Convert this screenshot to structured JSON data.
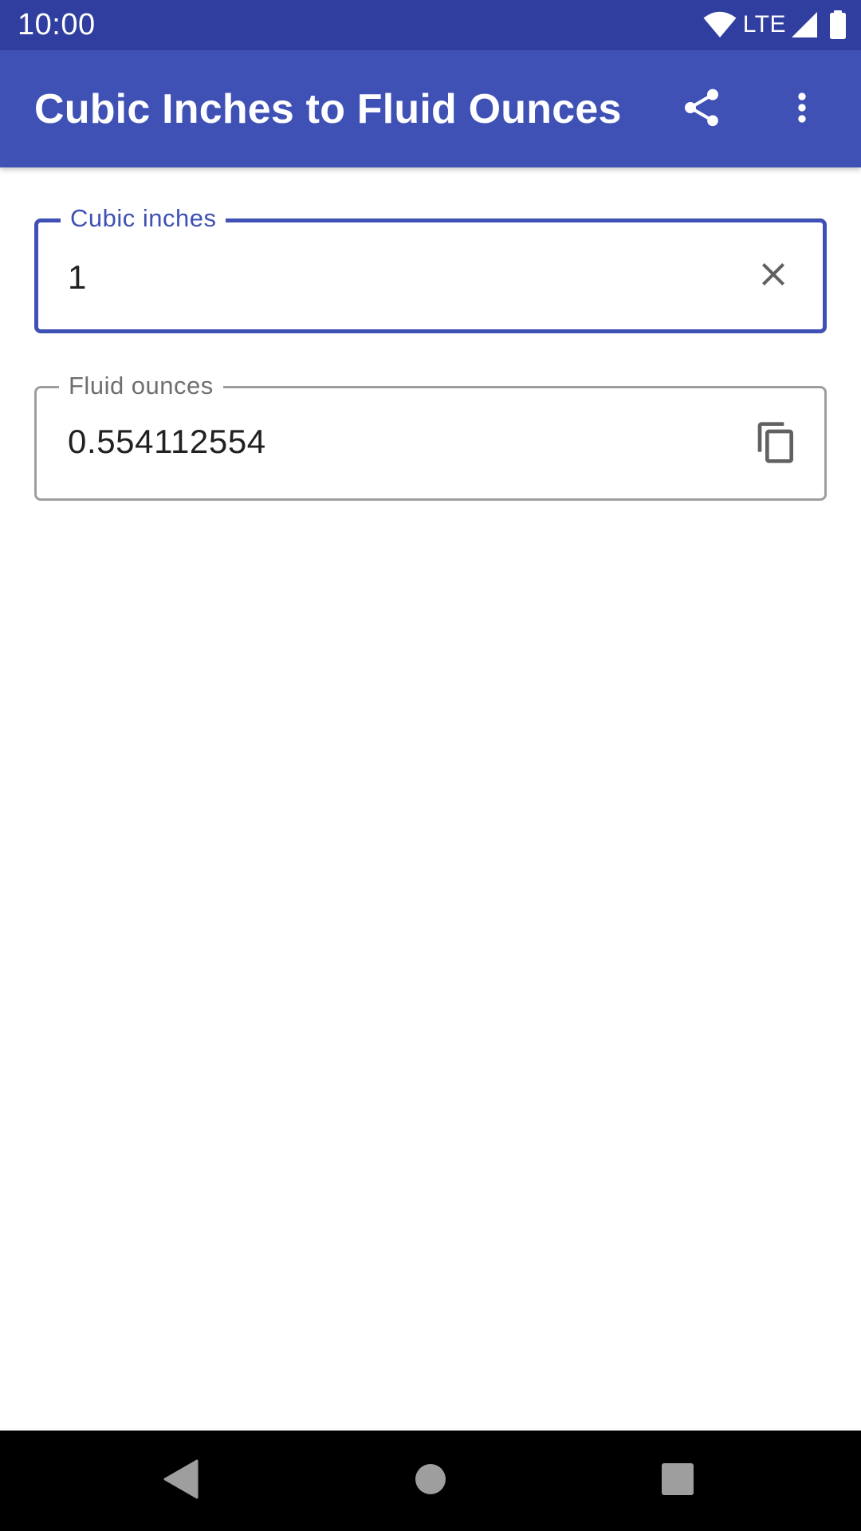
{
  "status_bar": {
    "time": "10:00",
    "network_label": "LTE",
    "icons": [
      "wifi-icon",
      "cell-signal-icon",
      "battery-icon"
    ]
  },
  "app_bar": {
    "title": "Cubic Inches to Fluid Ounces",
    "actions": [
      "share-icon",
      "more-vert-icon"
    ]
  },
  "input_field": {
    "label": "Cubic inches",
    "value": "1",
    "trailing_icon": "clear-icon"
  },
  "output_field": {
    "label": "Fluid ounces",
    "value": "0.554112554",
    "trailing_icon": "copy-icon"
  },
  "nav_bar": {
    "buttons": [
      "back-icon",
      "home-icon",
      "recents-icon"
    ]
  },
  "colors": {
    "status_bar": "#303f9f",
    "app_bar": "#3f51b5",
    "accent": "#3f51b5",
    "outline_inactive": "#9e9e9e",
    "text_primary": "#212121",
    "nav_bar": "#000000"
  }
}
